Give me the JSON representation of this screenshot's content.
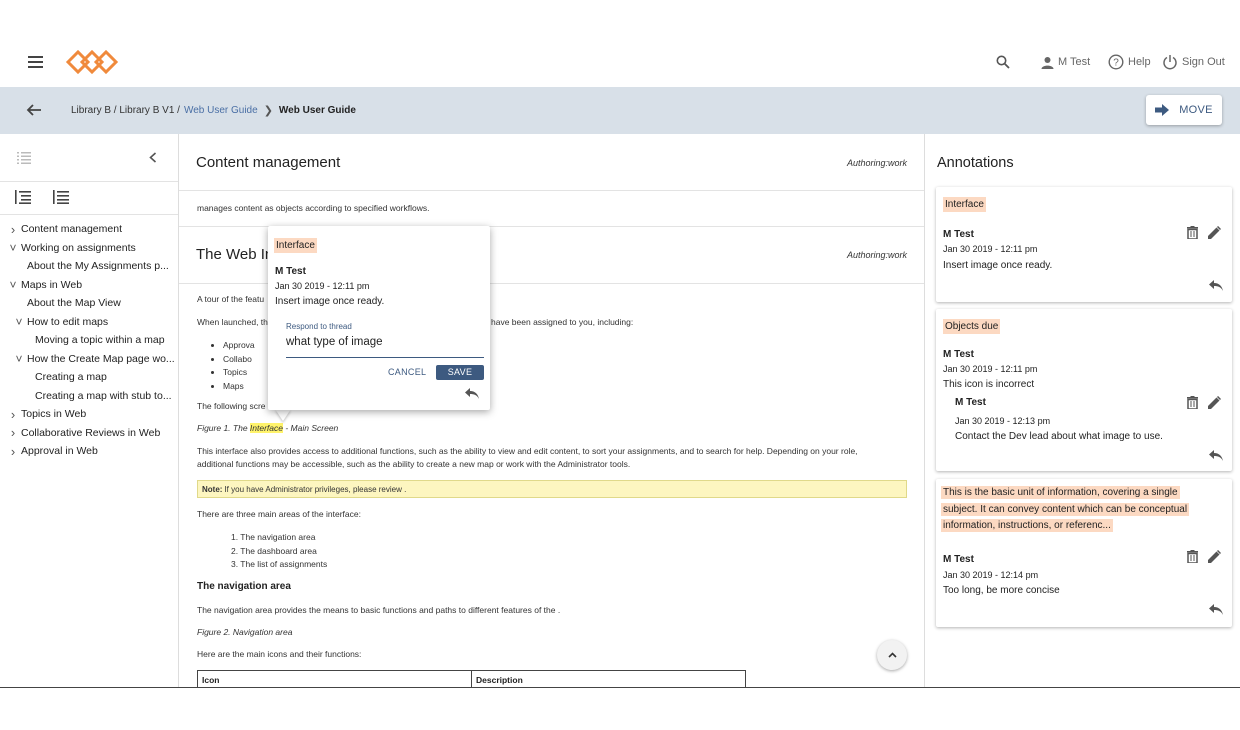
{
  "header": {
    "user_label": "M Test",
    "help_label": "Help",
    "signout_label": "Sign Out",
    "logo_color": "#f08a3c"
  },
  "breadcrumb": {
    "part1": "Library B / Library B V1 /",
    "link": "Web User Guide",
    "current": "Web User Guide",
    "move_label": "MOVE"
  },
  "tree": {
    "items": [
      {
        "label": "Content management",
        "level": 0,
        "state": "collapsed"
      },
      {
        "label": "Working on assignments",
        "level": 0,
        "state": "expanded"
      },
      {
        "label": "About the My Assignments p...",
        "level": 1,
        "state": "leaf"
      },
      {
        "label": "Maps in Web",
        "level": 0,
        "state": "expanded"
      },
      {
        "label": "About the Map View",
        "level": 1,
        "state": "leaf"
      },
      {
        "label": "How to edit maps",
        "level": 1,
        "state": "expanded"
      },
      {
        "label": "Moving a topic within a map",
        "level": 2,
        "state": "leaf"
      },
      {
        "label": "How the Create Map page wo...",
        "level": 1,
        "state": "expanded"
      },
      {
        "label": "Creating a map",
        "level": 2,
        "state": "leaf"
      },
      {
        "label": "Creating a map with stub to...",
        "level": 2,
        "state": "leaf"
      },
      {
        "label": "Topics in Web",
        "level": 0,
        "state": "collapsed"
      },
      {
        "label": "Collaborative Reviews in Web",
        "level": 0,
        "state": "collapsed"
      },
      {
        "label": "Approval in Web",
        "level": 0,
        "state": "collapsed"
      }
    ]
  },
  "content": {
    "section1_title": "Content management",
    "section1_tag": "Authoring:work",
    "section1_text": "manages content as objects according to specified workflows.",
    "section2_title": "The Web In",
    "section2_tag": "Authoring:work",
    "tour_text": "A tour of the featu",
    "launched_text": "When launched, th",
    "launched_tail": "have been assigned to you, including:",
    "bullets": [
      "Approva",
      "Collabo",
      "Topics",
      "Maps"
    ],
    "following_text": "The following scre",
    "fig1_prefix": "Figure 1. The ",
    "fig1_highlight": "Interface",
    "fig1_suffix": " - Main Screen",
    "interface_para1": "This interface also provides access to additional functions, such as the ability to view and edit content, to sort your assignments, and to search for help. Depending on your role,",
    "interface_para2": "additional functions may be accessible, such as the ability to create a new map or work with the Administrator tools.",
    "note_label": "Note:",
    "note_text": "If you have Administrator privileges, please review .",
    "three_areas": "There are three main areas of the interface:",
    "areas": [
      "1. The navigation area",
      "2. The dashboard area",
      "3. The list of assignments"
    ],
    "nav_heading": "The navigation area",
    "nav_text": "The navigation area provides the means to basic functions and paths to different features of the .",
    "fig2": "Figure 2. Navigation area",
    "main_icons": "Here are the main icons and their functions:",
    "table_headers": [
      "Icon",
      "Description"
    ]
  },
  "popup": {
    "tag": "Interface",
    "author": "M Test",
    "date": "Jan 30 2019 - 12:11 pm",
    "comment": "Insert image once ready.",
    "field_label": "Respond to thread",
    "field_value": "what type of image",
    "cancel_label": "CANCEL",
    "save_label": "SAVE"
  },
  "annotations": {
    "title": "Annotations",
    "cards": [
      {
        "tag": "Interface",
        "author": "M Test",
        "date": "Jan 30 2019 - 12:11 pm",
        "comment": "Insert image once ready."
      },
      {
        "tag": "Objects due",
        "author": "M Test",
        "date": "Jan 30 2019 - 12:11 pm",
        "comment": "This icon is incorrect",
        "reply_author": "M Test",
        "reply_date": "Jan 30 2019 - 12:13 pm",
        "reply_comment": "Contact the Dev lead about what image to use."
      },
      {
        "tag_lines": [
          "This is the basic unit of information, covering a single",
          "subject. It can convey content which can be conceptual",
          "information, instructions, or referenc..."
        ],
        "author": "M Test",
        "date": "Jan 30 2019 - 12:14 pm",
        "comment": "Too long, be more concise"
      }
    ]
  },
  "colors": {
    "accent": "#4a6fa5",
    "breadcrumb_bg": "#d8e0e8",
    "save_bg": "#3d5a80",
    "tag_highlight": "#fcd9c2",
    "text_highlight": "#fff36b"
  }
}
